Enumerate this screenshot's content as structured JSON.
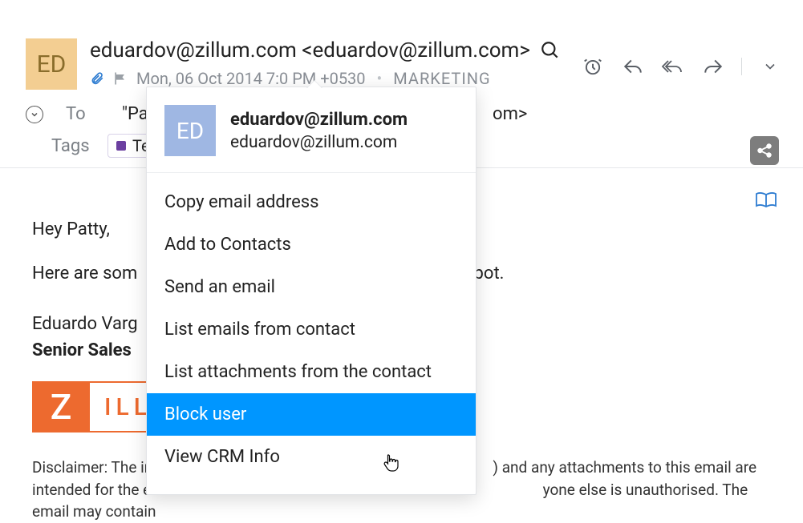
{
  "avatar_initials": "ED",
  "from_display": "eduardov@zillum.com <eduardov@zillum.com>",
  "date_line": "Mon, 06 Oct 2014 7:0       PM +0530",
  "category": "MARKETING",
  "to_label": "To",
  "to_value": "\"Patri                                                                           om>",
  "tags_label": "Tags",
  "tag1": "Tes",
  "body": {
    "greeting": "Hey Patty,",
    "line1": "Here are som                                                               ystery spot.",
    "sig_name": "Eduardo Varg",
    "sig_title": "Senior Sales ",
    "logo_left": "Z",
    "logo_right": "ILL",
    "disclaimer": "Disclaimer: The in                                                                                          ) and any attachments to this email are intended for the exclusive u                                                                                      yone else is unauthorised. The email may contain"
  },
  "popover": {
    "avatar": "ED",
    "name": "eduardov@zillum.com",
    "email": "eduardov@zillum.com",
    "items": [
      "Copy email address",
      "Add to Contacts",
      "Send an email",
      "List emails from contact",
      "List attachments from the contact",
      "Block user",
      "View CRM Info"
    ],
    "selected_index": 5
  }
}
